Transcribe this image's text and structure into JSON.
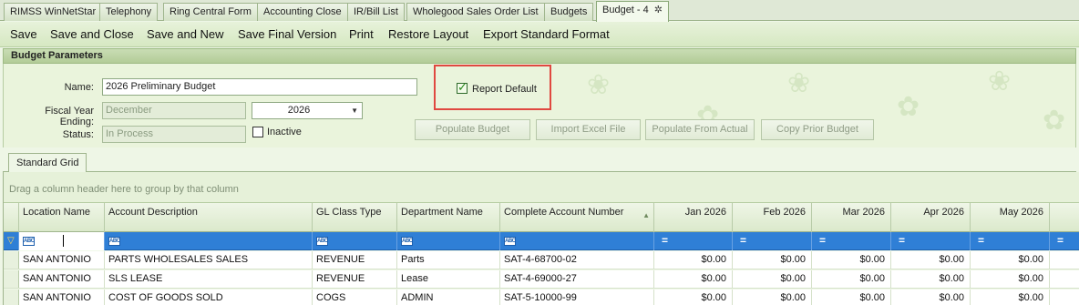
{
  "tabs": [
    {
      "label": "RIMSS WinNetStar"
    },
    {
      "label": "Telephony"
    },
    {
      "label": "Ring Central Form"
    },
    {
      "label": "Accounting Close"
    },
    {
      "label": "IR/Bill List"
    },
    {
      "label": "Wholegood Sales Order List"
    },
    {
      "label": "Budgets"
    },
    {
      "label": "Budget - 4",
      "active": true
    }
  ],
  "toolbar": {
    "save": "Save",
    "save_close": "Save and Close",
    "save_new": "Save and New",
    "save_final": "Save Final Version",
    "print": "Print",
    "restore_layout": "Restore Layout",
    "export": "Export Standard Format"
  },
  "params": {
    "header": "Budget Parameters",
    "name_label": "Name:",
    "name_value": "2026 Preliminary Budget",
    "fiscal_label": "Fiscal Year Ending:",
    "fiscal_month": "December",
    "fiscal_year": "2026",
    "status_label": "Status:",
    "status_value": "In Process",
    "inactive_label": "Inactive",
    "inactive_checked": false,
    "report_default_label": "Report Default",
    "report_default_checked": true,
    "buttons": {
      "populate_budget": "Populate Budget",
      "import_excel": "Import Excel File",
      "populate_actual": "Populate From Actual",
      "copy_prior": "Copy Prior Budget"
    }
  },
  "grid": {
    "tab_label": "Standard Grid",
    "group_hint": "Drag a column header here to group by that column",
    "columns": [
      "Location Name",
      "Account Description",
      "GL Class Type",
      "Department Name",
      "Complete Account Number",
      "Jan 2026",
      "Feb 2026",
      "Mar 2026",
      "Apr 2026",
      "May 2026"
    ],
    "rows": [
      [
        "SAN ANTONIO",
        "PARTS WHOLESALES SALES",
        "REVENUE",
        "Parts",
        "SAT-4-68700-02",
        "$0.00",
        "$0.00",
        "$0.00",
        "$0.00",
        "$0.00"
      ],
      [
        "SAN ANTONIO",
        "SLS LEASE",
        "REVENUE",
        "Lease",
        "SAT-4-69000-27",
        "$0.00",
        "$0.00",
        "$0.00",
        "$0.00",
        "$0.00"
      ],
      [
        "SAN ANTONIO",
        "COST OF GOODS SOLD",
        "COGS",
        "ADMIN",
        "SAT-5-10000-99",
        "$0.00",
        "$0.00",
        "$0.00",
        "$0.00",
        "$0.00"
      ]
    ]
  },
  "colors": {
    "filter_row": "#2f7fd6",
    "highlight": "#e04840",
    "theme_green": "#d6e8c2"
  }
}
